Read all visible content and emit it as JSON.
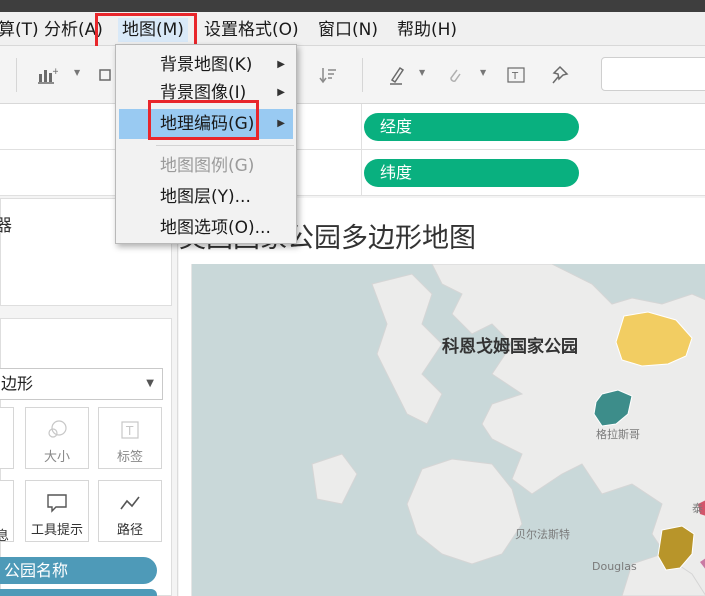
{
  "menubar": {
    "items": [
      {
        "label": "算(T)"
      },
      {
        "label": "分析(A)"
      },
      {
        "label": "地图(M)"
      },
      {
        "label": "设置格式(O)"
      },
      {
        "label": "窗口(N)"
      },
      {
        "label": "帮助(H)"
      }
    ]
  },
  "map_menu": {
    "items": [
      {
        "label": "背景地图(K)"
      },
      {
        "label": "背景图像(I)"
      },
      {
        "label": "地理编码(G)"
      },
      {
        "label": "地图图例(G)"
      },
      {
        "label": "地图层(Y)..."
      },
      {
        "label": "地图选项(O)..."
      }
    ]
  },
  "shelves": {
    "columns_pill": "经度",
    "rows_pill": "纬度"
  },
  "left_pane": {
    "partial_label": "器",
    "mark_type": "边形",
    "marks": {
      "size": "大小",
      "label": "标签",
      "detail_partial": "息",
      "tooltip": "工具提示",
      "path": "路径"
    },
    "field_pills": [
      "公园名称"
    ]
  },
  "view": {
    "title": "英国国家公园多边形地图",
    "map_labels": {
      "park": "科恩戈姆国家公园",
      "glasgow": "格拉斯哥",
      "belfast": "贝尔法斯特",
      "douglas": "Douglas",
      "partial": "泰"
    }
  },
  "colors": {
    "accent_green": "#09b07f",
    "pill_blue": "#4e9ab8",
    "highlight_red": "#e8262b",
    "park_yellow": "#f2cd62",
    "park_teal": "#3d8d8a",
    "park_olive": "#b8952a"
  }
}
